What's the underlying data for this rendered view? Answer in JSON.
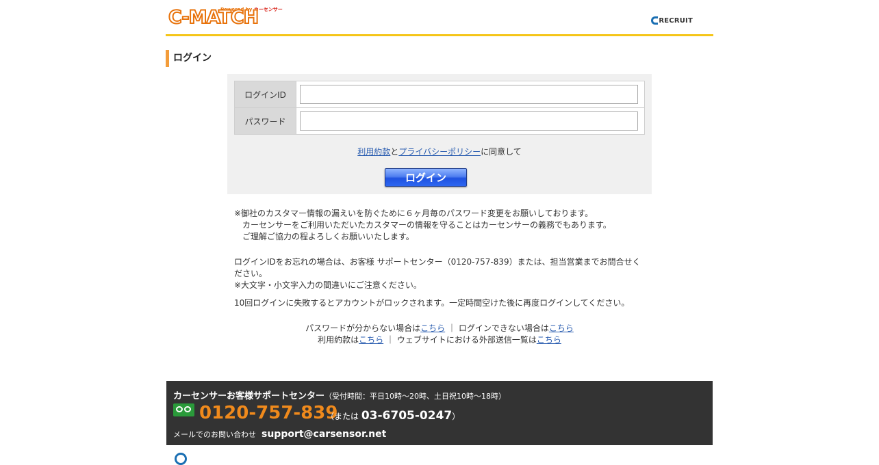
{
  "header": {
    "powered_prefix": "Powered by",
    "powered_brand": "カーセンサー",
    "logo_text": "C-MATCH",
    "recruit_text": "RECRUIT"
  },
  "page_title": "ログイン",
  "form": {
    "login_id_label": "ログインID",
    "login_id_value": "",
    "password_label": "パスワード",
    "password_value": "",
    "terms_link": "利用約款",
    "and_text": "と",
    "privacy_link": "プライバシーポリシー",
    "agree_suffix": "に同意して",
    "login_button": "ログイン"
  },
  "notes": {
    "n1_line1": "※御社のカスタマー情報の漏えいを防ぐために６ヶ月毎のパスワード変更をお願いしております。",
    "n1_line2": "カーセンサーをご利用いただいたカスタマーの情報を守ることはカーセンサーの義務でもあります。",
    "n1_line3": "ご理解ご協力の程よろしくお願いいたします。",
    "n2_line1": "ログインIDをお忘れの場合は、お客様 サポートセンター（0120-757-839）または、担当営業までお問合せください。",
    "n2_line2": "※大文字・小文字入力の間違いにご注意ください。",
    "n3": "10回ログインに失敗するとアカウントがロックされます。一定時間空けた後に再度ログインしてください。"
  },
  "links": {
    "forgot_password_text": "パスワードが分からない場合は",
    "forgot_password_link": "こちら",
    "separator": "｜",
    "cannot_login_text": "ログインできない場合は",
    "cannot_login_link": "こちら",
    "terms_text": "利用約款は",
    "terms_link": "こちら",
    "external_text": "ウェブサイトにおける外部送信一覧は",
    "external_link": "こちら"
  },
  "footer": {
    "center_name": "カーセンサーお客様サポートセンター",
    "hours": "（受付時間：平日10時〜20時、土日祝10時〜18時）",
    "phone": "0120-757-839",
    "alt_prefix": "（または",
    "alt_phone": "03-6705-0247",
    "alt_suffix": "）",
    "mail_label": "メールでのお問い合わせ",
    "mail_address": "support@carsensor.net"
  },
  "colors": {
    "brand_orange": "#e8730c",
    "header_rule": "#f5c518",
    "link": "#2a5db0",
    "footer_bg": "#333333",
    "phone": "#f08a1c"
  }
}
